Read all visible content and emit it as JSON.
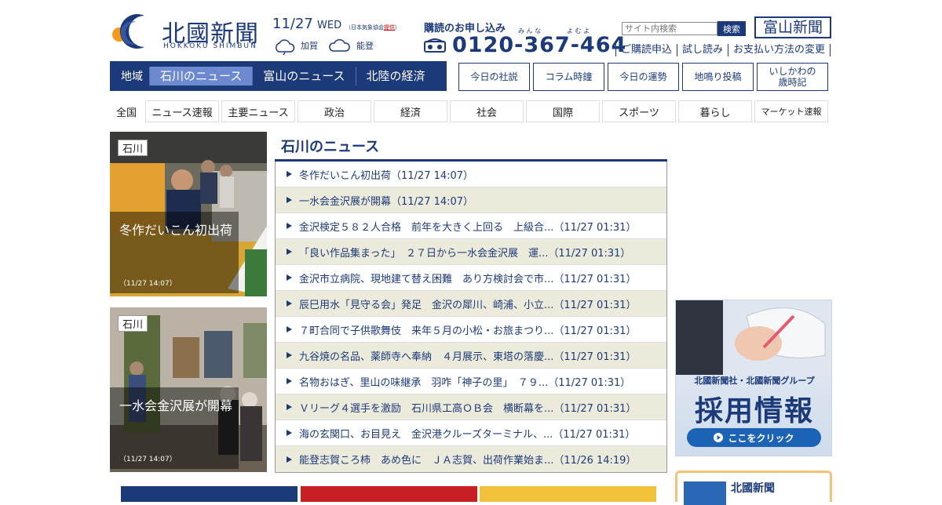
{
  "brand": {
    "name": "北國新聞",
    "romaji": "HOKKOKU SHIMBUN",
    "colors": {
      "navy": "#1c3a7a",
      "accent_orange": "#f39a17",
      "active_tab": "#6d8ad0"
    }
  },
  "date_bar": {
    "date": "11/27",
    "weekday": "WED",
    "source_prefix": "（日本気象協会",
    "source_link": "提供",
    "source_suffix": "）",
    "weather": [
      {
        "area": "加賀",
        "icon": "sun-cloud-icon"
      },
      {
        "area": "能登",
        "icon": "cloud-icon"
      }
    ]
  },
  "subscribe": {
    "title": "購読のお申し込み",
    "ruby_mina": "み ん な",
    "ruby_yomu": "よ む よ",
    "phone": "0120-367-464",
    "icon": "phone-icon"
  },
  "search": {
    "placeholder": "サイト内検索",
    "button": "検索"
  },
  "toyama_link": "富山新聞",
  "sub_links": [
    "ご購読申込",
    "試し読み",
    "お支払い方法の変更"
  ],
  "region_nav": {
    "label": "地域",
    "tabs": [
      "石川のニュース",
      "富山のニュース",
      "北陸の経済"
    ]
  },
  "feature_buttons": [
    "今日の社説",
    "コラム時鐘",
    "今日の運勢",
    "地鳴り投稿",
    "いしかわの\n歳時記"
  ],
  "category_nav": {
    "all": "全国",
    "items": [
      "ニュース速報",
      "主要ニュース",
      "政治",
      "経済",
      "社会",
      "国際",
      "スポーツ",
      "暮らし",
      "マーケット速報"
    ]
  },
  "photo_cards": [
    {
      "badge": "石川",
      "title": "冬作だいこん初出荷",
      "time": "（11/27 14:07）"
    },
    {
      "badge": "石川",
      "title": "一水会金沢展が開幕",
      "time": "（11/27 14:07）"
    }
  ],
  "news": {
    "heading": "石川のニュース",
    "items": [
      "冬作だいこん初出荷（11/27 14:07）",
      "一水会金沢展が開幕（11/27 14:07）",
      "金沢検定５８２人合格　前年を大きく上回る　上級合...（11/27 01:31）",
      "「良い作品集まった」　２７日から一水会金沢展　運...（11/27 01:31）",
      "金沢市立病院、現地建て替え困難　あり方検討会で市...（11/27 01:31）",
      "辰巳用水「見守る会」発足　金沢の犀川、崎浦、小立...（11/27 01:31）",
      "７町合同で子供歌舞伎　来年５月の小松・お旅まつり...（11/27 01:31）",
      "九谷焼の名品、薬師寺へ奉納　４月展示、東塔の落慶...（11/27 01:31）",
      "名物おはぎ、里山の味継承　羽咋「神子の里」　７９...（11/27 01:31）",
      "Ｖリーグ４選手を激励　石川県工高ＯＢ会　横断幕を...（11/27 01:31）",
      "海の玄関口、お目見え　金沢港クルーズターミナル、...（11/27 01:31）",
      "能登志賀ころ柿　あめ色に　ＪＡ志賀、出荷作業始ま...（11/26 14:19）"
    ]
  },
  "recruit_ad": {
    "org": "北國新聞社・北國新聞グループ",
    "title": "採用情報",
    "button": "ここをクリック"
  },
  "sub_box": {
    "title": "北國新聞"
  }
}
